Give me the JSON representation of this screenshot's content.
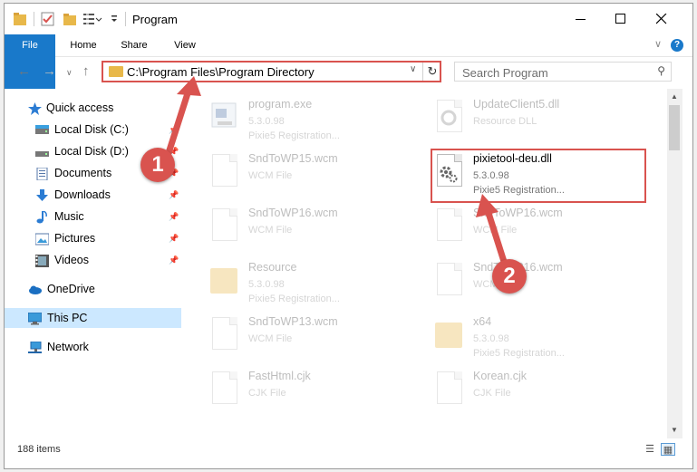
{
  "window": {
    "title": "Program"
  },
  "ribbon": {
    "file": "File",
    "home": "Home",
    "share": "Share",
    "view": "View"
  },
  "address": {
    "path": "C:\\Program Files\\Program Directory"
  },
  "search": {
    "placeholder": "Search Program"
  },
  "sidebar": {
    "items": [
      {
        "label": "Quick access",
        "icon": "star-icon"
      },
      {
        "label": "Local Disk (C:)",
        "icon": "drive-icon"
      },
      {
        "label": "Local Disk (D:)",
        "icon": "drive-icon"
      },
      {
        "label": "Documents",
        "icon": "documents-icon"
      },
      {
        "label": "Downloads",
        "icon": "download-icon"
      },
      {
        "label": "Music",
        "icon": "music-icon"
      },
      {
        "label": "Pictures",
        "icon": "pictures-icon"
      },
      {
        "label": "Videos",
        "icon": "videos-icon"
      },
      {
        "label": "OneDrive",
        "icon": "cloud-icon"
      },
      {
        "label": "This PC",
        "icon": "computer-icon"
      },
      {
        "label": "Network",
        "icon": "network-icon"
      }
    ]
  },
  "files": [
    {
      "name": "program.exe",
      "line1": "5.3.0.98",
      "line2": "Pixie5 Registration..."
    },
    {
      "name": "UpdateClient5.dll",
      "line1": "Resource DLL",
      "line2": ""
    },
    {
      "name": "SndToWP15.wcm",
      "line1": "WCM File",
      "line2": ""
    },
    {
      "name": "pixietool-deu.dll",
      "line1": "5.3.0.98",
      "line2": "Pixie5 Registration..."
    },
    {
      "name": "SndToWP16.wcm",
      "line1": "WCM File",
      "line2": ""
    },
    {
      "name": "SndToWP16.wcm",
      "line1": "WCM File",
      "line2": ""
    },
    {
      "name": "Resource",
      "line1": "5.3.0.98",
      "line2": "Pixie5 Registration..."
    },
    {
      "name": "SndToWP16.wcm",
      "line1": "WCM File",
      "line2": ""
    },
    {
      "name": "SndToWP13.wcm",
      "line1": "WCM File",
      "line2": ""
    },
    {
      "name": "x64",
      "line1": "5.3.0.98",
      "line2": "Pixie5 Registration..."
    },
    {
      "name": "FastHtml.cjk",
      "line1": "CJK File",
      "line2": ""
    },
    {
      "name": "Korean.cjk",
      "line1": "CJK File",
      "line2": ""
    }
  ],
  "status": {
    "count": "188 items"
  },
  "annotations": {
    "step1": "1",
    "step2": "2"
  },
  "colors": {
    "accent": "#1979ca",
    "highlight": "#d9534f",
    "selection": "#cce8ff"
  }
}
